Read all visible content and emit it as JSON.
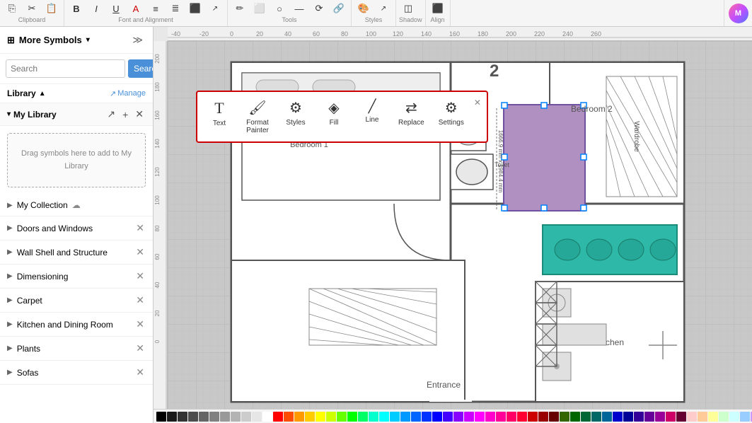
{
  "app": {
    "logo_text": "M"
  },
  "toolbar": {
    "sections": [
      {
        "name": "Clipboard",
        "buttons": [
          "⎘",
          "✂",
          "📋",
          "🖌"
        ]
      },
      {
        "name": "Font and Alignment",
        "buttons": [
          "B",
          "I",
          "U",
          "A",
          "≡",
          "≣",
          "⬛"
        ]
      },
      {
        "name": "Tools",
        "buttons": [
          "✏",
          "⬜",
          "○",
          "—",
          "⟳",
          "🔗"
        ]
      },
      {
        "name": "Styles",
        "buttons": [
          "🎨",
          "📐"
        ]
      },
      {
        "name": "Shadow",
        "buttons": [
          "◫"
        ]
      },
      {
        "name": "Align",
        "buttons": [
          "⬛",
          "⬛"
        ]
      }
    ]
  },
  "sidebar": {
    "title": "More Symbols",
    "search_placeholder": "Search",
    "search_btn": "Search",
    "library_label": "Library",
    "manage_label": "Manage",
    "my_library_label": "My Library",
    "drop_zone_text": "Drag symbols here to add to My Library",
    "categories": [
      {
        "name": "My Collection",
        "has_cloud": true,
        "closeable": false
      },
      {
        "name": "Doors and Windows",
        "has_cloud": false,
        "closeable": true
      },
      {
        "name": "Wall Shell and Structure",
        "has_cloud": false,
        "closeable": true
      },
      {
        "name": "Dimensioning",
        "has_cloud": false,
        "closeable": true
      },
      {
        "name": "Carpet",
        "has_cloud": false,
        "closeable": true
      },
      {
        "name": "Kitchen and Dining Room",
        "has_cloud": false,
        "closeable": true
      },
      {
        "name": "Plants",
        "has_cloud": false,
        "closeable": true
      },
      {
        "name": "Sofas",
        "has_cloud": false,
        "closeable": true
      }
    ]
  },
  "floating_toolbar": {
    "items": [
      {
        "icon": "T",
        "label": "Text"
      },
      {
        "icon": "🖌",
        "label": "Format Painter"
      },
      {
        "icon": "⚙",
        "label": "Styles"
      },
      {
        "icon": "◈",
        "label": "Fill"
      },
      {
        "icon": "—",
        "label": "Line"
      },
      {
        "icon": "⟳",
        "label": "Replace"
      },
      {
        "icon": "⚙",
        "label": "Settings"
      }
    ]
  },
  "color_palette": {
    "colors": [
      "#000000",
      "#1a1a1a",
      "#333333",
      "#4d4d4d",
      "#666666",
      "#808080",
      "#999999",
      "#b3b3b3",
      "#cccccc",
      "#e6e6e6",
      "#ffffff",
      "#ff0000",
      "#ff4d00",
      "#ff9900",
      "#ffcc00",
      "#ffff00",
      "#ccff00",
      "#66ff00",
      "#00ff00",
      "#00ff66",
      "#00ffcc",
      "#00ffff",
      "#00ccff",
      "#0099ff",
      "#0066ff",
      "#0033ff",
      "#0000ff",
      "#4400ff",
      "#8800ff",
      "#cc00ff",
      "#ff00ff",
      "#ff00cc",
      "#ff0099",
      "#ff0066",
      "#ff0033",
      "#cc0000",
      "#990000",
      "#660000",
      "#336600",
      "#006600",
      "#006633",
      "#006666",
      "#006699",
      "#0000cc",
      "#000099",
      "#330099",
      "#660099",
      "#990099",
      "#cc0066",
      "#660033",
      "#ffcccc",
      "#ffcc99",
      "#ffff99",
      "#ccffcc",
      "#ccffff",
      "#99ccff",
      "#cc99ff",
      "#ffccff",
      "#ff99cc",
      "#ffcc66"
    ]
  },
  "ruler": {
    "h_marks": [
      "-40",
      "-20",
      "0",
      "20",
      "40",
      "60",
      "80",
      "100",
      "120",
      "140",
      "160",
      "180",
      "200",
      "220",
      "240",
      "260"
    ],
    "v_marks": [
      "200",
      "180",
      "160",
      "140",
      "120",
      "100",
      "80"
    ]
  }
}
